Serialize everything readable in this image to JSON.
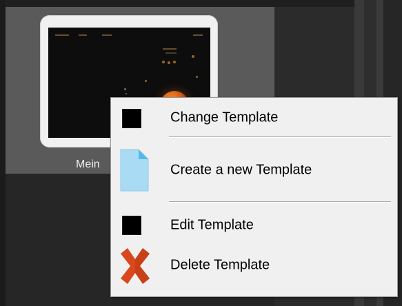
{
  "thumbnail": {
    "label": "Mein"
  },
  "context_menu": {
    "items": [
      {
        "label": "Change Template",
        "icon": "black-square-icon"
      },
      {
        "label": "Create a new Template",
        "icon": "document-icon"
      },
      {
        "label": "Edit Template",
        "icon": "black-square-icon"
      },
      {
        "label": "Delete Template",
        "icon": "red-x-icon"
      }
    ]
  },
  "colors": {
    "menu_background": "#f0f0f0",
    "tile_background": "#5a5a5a",
    "document_icon": "#a9dcf4",
    "delete_icon": "#d9481c"
  }
}
